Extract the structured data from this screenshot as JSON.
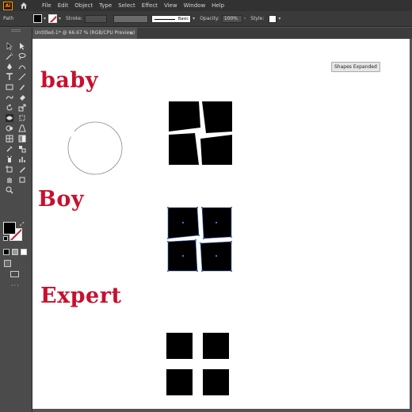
{
  "app": {
    "logo_text": "Ai",
    "menu": [
      "File",
      "Edit",
      "Object",
      "Type",
      "Select",
      "Effect",
      "View",
      "Window",
      "Help"
    ]
  },
  "control_bar": {
    "selection_type": "Path",
    "stroke_label": "Stroke:",
    "stroke_profile": "Basic",
    "opacity_label": "Opacity:",
    "opacity_value": "100%",
    "style_label": "Style:"
  },
  "document": {
    "tab_title": "Untitled-1* @ 66.67 % (RGB/CPU Preview)",
    "close_glyph": "×"
  },
  "toolbar": {
    "more_tools": "···"
  },
  "artboard": {
    "words": {
      "top": "baby",
      "middle": "Boy",
      "bottom": "Expert"
    },
    "tooltip": "Shapes Expanded"
  },
  "colors": {
    "accent_red": "#c8102e",
    "ui_dark": "#323232",
    "selection_blue": "#4f6fd8"
  }
}
